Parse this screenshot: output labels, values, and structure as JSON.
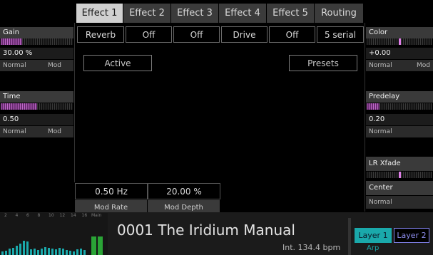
{
  "tabs": [
    {
      "label": "Effect 1",
      "active": true
    },
    {
      "label": "Effect 2",
      "active": false
    },
    {
      "label": "Effect 3",
      "active": false
    },
    {
      "label": "Effect 4",
      "active": false
    },
    {
      "label": "Effect 5",
      "active": false
    },
    {
      "label": "Routing",
      "active": false
    }
  ],
  "slots": [
    "Reverb",
    "Off",
    "Off",
    "Drive",
    "Off",
    "5 serial"
  ],
  "buttons": {
    "active": "Active",
    "presets": "Presets"
  },
  "left": {
    "gain": {
      "label": "Gain",
      "value": "30.00 %",
      "mode": "Normal",
      "mod": "Mod",
      "level": 0.3
    },
    "time": {
      "label": "Time",
      "value": "0.50",
      "mode": "Normal",
      "mod": "Mod",
      "level": 0.5
    }
  },
  "right": {
    "color": {
      "label": "Color",
      "value": "+0.00",
      "mode": "Normal",
      "mod": "Mod",
      "level": 0.5
    },
    "predelay": {
      "label": "Predelay",
      "value": "0.20",
      "mode": "Normal",
      "level": 0.2
    },
    "lr_xfade": {
      "label": "LR Xfade",
      "level": 0.5
    },
    "center": {
      "label": "Center",
      "mode": "Normal"
    }
  },
  "params": [
    {
      "value": "0.50 Hz",
      "label": "Mod Rate"
    },
    {
      "value": "20.00 %",
      "label": "Mod Depth"
    }
  ],
  "bottom": {
    "meter_numbers": [
      "2",
      "4",
      "6",
      "8",
      "10",
      "12",
      "14",
      "16"
    ],
    "main_label": "Main",
    "preset_name": "0001 The Iridium Manual",
    "clock": "Int. 134.4 bpm",
    "layer1": "Layer 1",
    "layer2": "Layer 2",
    "arp": "Arp"
  },
  "colors": {
    "accent_pink": "#d66ae0",
    "teal": "#1aa9ab",
    "layer2_blue": "#7f7fe6",
    "meter_green": "#2aa436"
  }
}
